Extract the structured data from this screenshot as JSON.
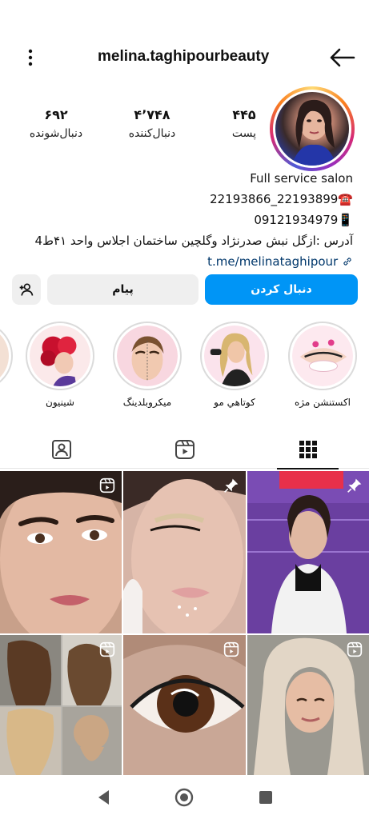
{
  "header": {
    "username": "melina.taghipourbeauty",
    "menu_icon": "more-vertical-icon",
    "back_icon": "arrow-left-icon"
  },
  "stats": [
    {
      "value": "۴۴۵",
      "label": "پست"
    },
    {
      "value": "۴٬۷۴۸",
      "label": "دنبال‌کننده"
    },
    {
      "value": "۶۹۲",
      "label": "دنبال‌شونده"
    }
  ],
  "bio": {
    "line1": "Full service salon",
    "line2": "22193866_22193899☎️",
    "line3": "09121934979📱",
    "line4": "آدرس :ازگل نبش صدرنژاد وگلچین ساختمان اجلاس واحد ۴۱ط4",
    "link": "t.me/melinataghipour"
  },
  "actions": {
    "follow_label": "دنبال کردن",
    "message_label": "پیام",
    "add_user_icon": "add-user-icon"
  },
  "highlights": [
    {
      "label": "اکستنشن مژه"
    },
    {
      "label": "کوتاهي مو"
    },
    {
      "label": "میکروبلدینگ"
    },
    {
      "label": "شینیون"
    }
  ],
  "tabs": [
    {
      "icon": "tagged-icon"
    },
    {
      "icon": "reels-icon"
    },
    {
      "icon": "grid-icon",
      "active": true
    }
  ],
  "colors": {
    "follow_button": "#0095f6",
    "secondary_button": "#efefef",
    "link": "#00376b"
  }
}
